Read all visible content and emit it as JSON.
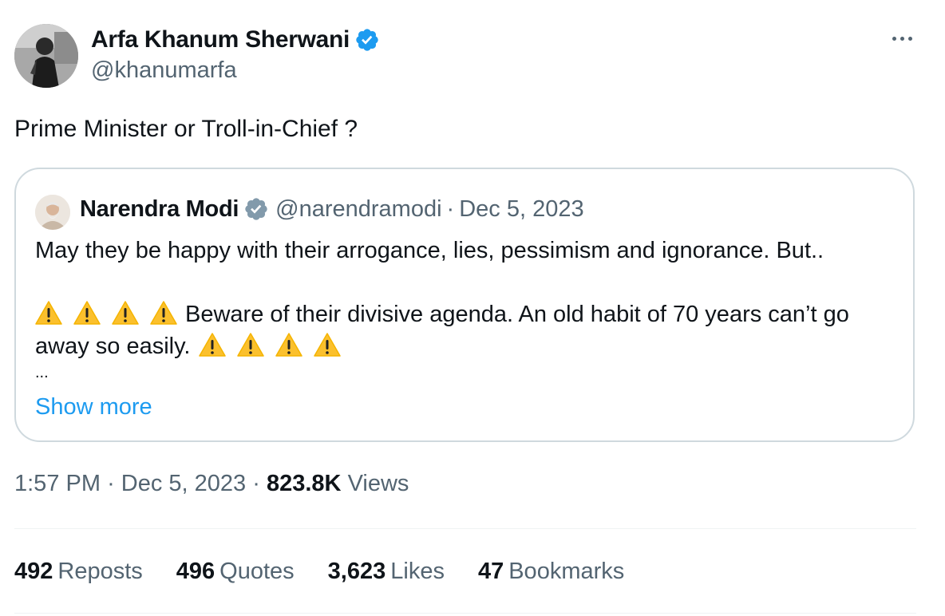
{
  "author": {
    "name": "Arfa Khanum Sherwani",
    "handle": "@khanumarfa",
    "verified": true
  },
  "tweet": {
    "text": "Prime Minister or Troll-in-Chief ?"
  },
  "quoted": {
    "name": "Narendra Modi",
    "handle": "@narendramodi",
    "separator": "·",
    "date": "Dec 5, 2023",
    "line1": "May they be happy with their arrogance, lies, pessimism and ignorance. But..",
    "line2": "Beware of their divisive agenda. An old habit of 70 years can’t go",
    "line3": "away so easily.",
    "ellipsis": "...",
    "show_more": "Show more"
  },
  "meta": {
    "time": "1:57 PM",
    "sep1": "·",
    "date": "Dec 5, 2023",
    "sep2": "·",
    "views_count": "823.8K",
    "views_label": "Views"
  },
  "stats": [
    {
      "count": "492",
      "label": "Reposts"
    },
    {
      "count": "496",
      "label": "Quotes"
    },
    {
      "count": "3,623",
      "label": "Likes"
    },
    {
      "count": "47",
      "label": "Bookmarks"
    }
  ],
  "colors": {
    "verified_blue": "#1d9bf0",
    "verified_gray": "#829aab",
    "secondary_text": "#536471",
    "link_blue": "#1d9bf0",
    "border": "#cfd9de",
    "warning_yellow": "#fbc02d"
  },
  "icons": {
    "verified": "verified-badge-icon",
    "warning": "warning-sign-icon",
    "more": "more-dots-icon"
  }
}
